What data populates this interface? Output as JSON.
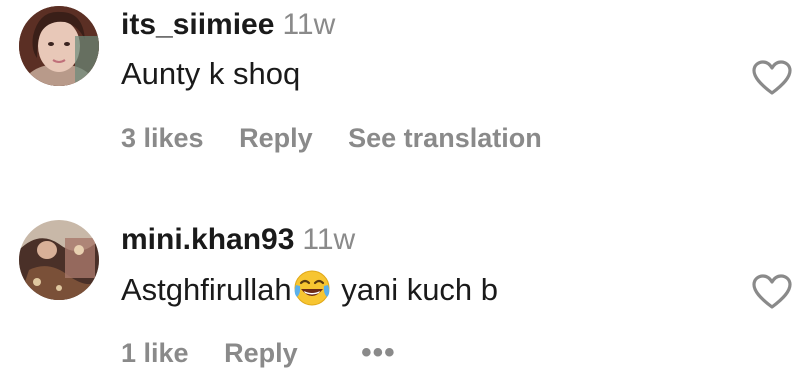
{
  "comments": [
    {
      "username": "its_siimiee",
      "time": "11w",
      "text": "Aunty k shoq",
      "likes": "3 likes",
      "reply": "Reply",
      "translate": "See translation"
    },
    {
      "username": "mini.khan93",
      "time": "11w",
      "text_before": "Astghfirullah",
      "text_after": " yani kuch b",
      "emoji": "face-with-tears-of-joy",
      "likes": "1 like",
      "reply": "Reply",
      "more": "•••"
    }
  ],
  "colors": {
    "primary_text": "#1a1a1a",
    "secondary_text": "#8a8a8a",
    "heart_outline": "#8a8a8a"
  },
  "icons": {
    "like": "heart-outline-icon",
    "more": "more-horizontal-icon"
  }
}
